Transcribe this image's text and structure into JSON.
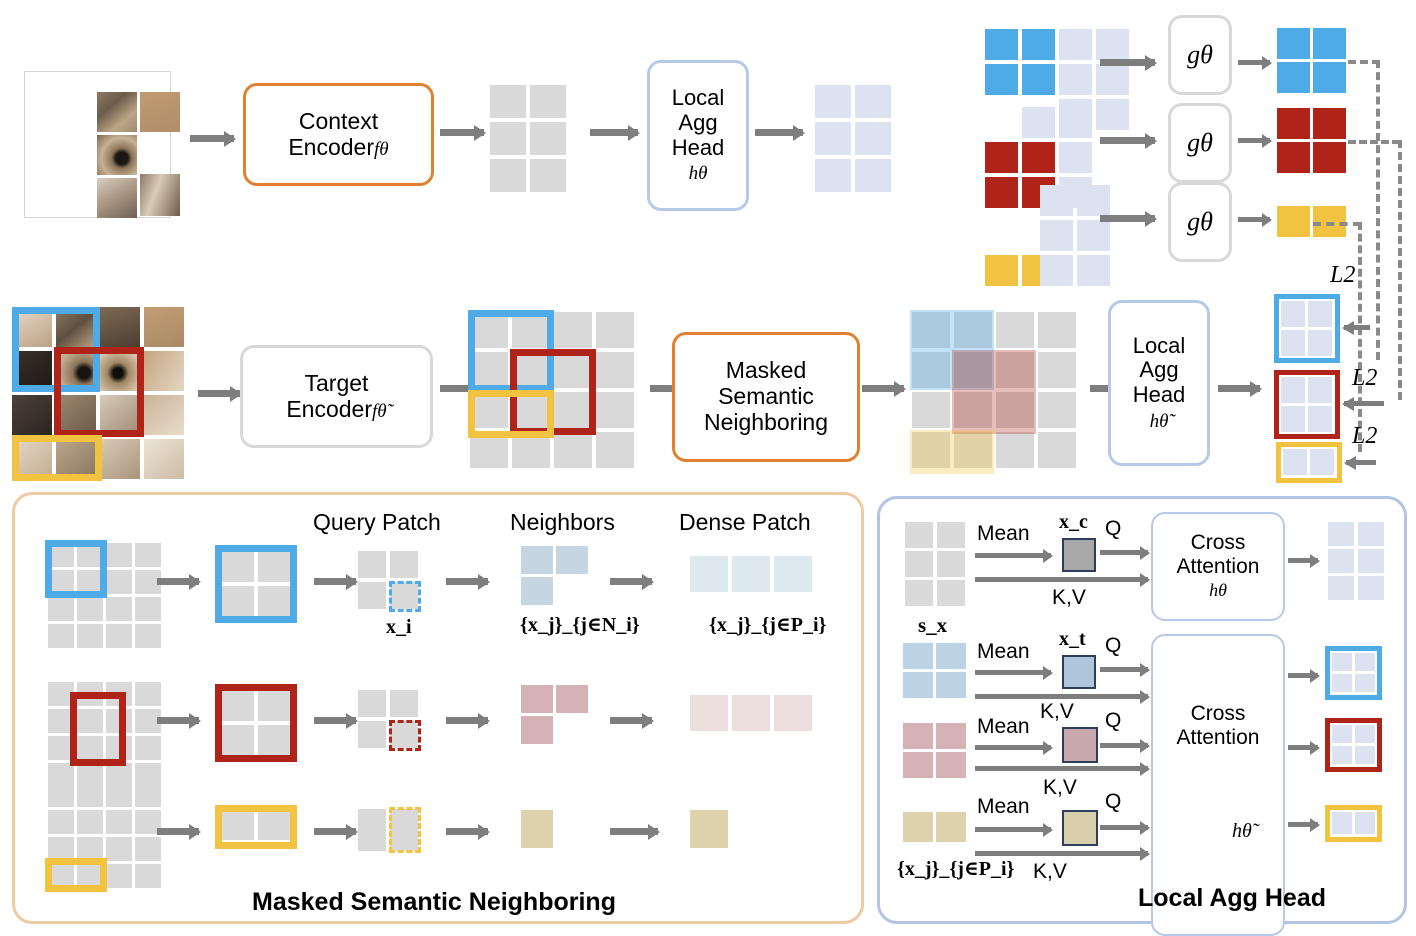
{
  "figure": {
    "type": "architecture-diagram",
    "topic": "Masked Semantic Neighboring self-supervised learning pipeline"
  },
  "row1": {
    "context_encoder": {
      "line1": "Context",
      "line2": "Encoder",
      "sub": "fθ"
    },
    "local_agg_head": {
      "line1": "Local",
      "line2": "Agg",
      "line3": "Head",
      "sub": "hθ"
    },
    "g_heads": [
      {
        "label": "gθ"
      },
      {
        "label": "gθ"
      },
      {
        "label": "gθ"
      }
    ]
  },
  "row2": {
    "target_encoder": {
      "line1": "Target",
      "line2": "Encoder",
      "sub": "fθ̃"
    },
    "msn_box": {
      "line1": "Masked",
      "line2": "Semantic",
      "line3": "Neighboring"
    },
    "local_agg_head": {
      "line1": "Local",
      "line2": "Agg",
      "line3": "Head",
      "sub": "hθ̃"
    },
    "losses": [
      {
        "label": "L2"
      },
      {
        "label": "L2"
      },
      {
        "label": "L2"
      }
    ]
  },
  "panel_left": {
    "title": "Masked Semantic Neighboring",
    "columns": [
      {
        "label": "Query Patch"
      },
      {
        "label": "Neighbors"
      },
      {
        "label": "Dense Patch"
      }
    ],
    "captions": {
      "query": "x_i",
      "neighbors": "{x_j}_{j∈N_i}",
      "dense": "{x_j}_{j∈P_i}"
    },
    "rows": [
      {
        "color": "blue",
        "grid": "4x4",
        "patch": "2x2"
      },
      {
        "color": "red",
        "grid": "4x4",
        "patch": "2x2"
      },
      {
        "color": "yellow",
        "grid": "4x4",
        "patch": "1x2"
      }
    ]
  },
  "panel_right": {
    "title": "Local Agg Head",
    "input_label_top": "s_x",
    "input_label_bottom": "{x_j}_{j∈P_i}",
    "mean_label": "Mean",
    "q_label": "Q",
    "kv_label": "K,V",
    "cross_attention_top": {
      "line1": "Cross",
      "line2": "Attention",
      "sub": "hθ"
    },
    "cross_attention_bottom": {
      "line1": "Cross",
      "line2": "Attention",
      "sub": "hθ̃"
    },
    "token_labels": {
      "context": "x_c",
      "target": "x_t"
    },
    "rows": [
      {
        "color": "grey",
        "token": "x_c"
      },
      {
        "color": "blue",
        "token": "x_t"
      },
      {
        "color": "red",
        "token": ""
      },
      {
        "color": "yellow",
        "token": ""
      }
    ]
  },
  "colors": {
    "blue": "#4FAAE8",
    "red": "#AF2318",
    "yellow": "#F2C340",
    "grey_cell": "#D9D9D9",
    "pale_cell": "#DCE2EF",
    "orange_border": "#E08030",
    "blue_border": "#B6C9E8",
    "peach_panel": "#F0C9A5",
    "lblue_panel": "#B3C4E5",
    "arrow": "#7E7E7E"
  }
}
